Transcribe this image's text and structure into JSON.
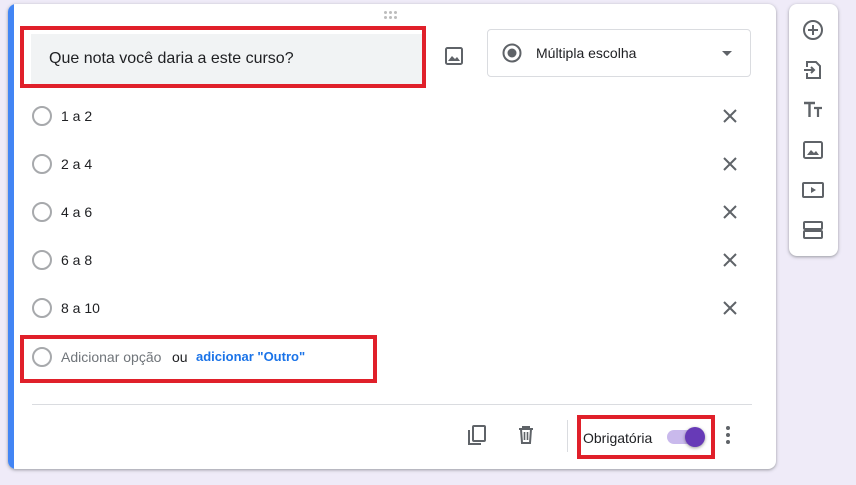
{
  "question": {
    "title": "Que nota você daria a este curso?",
    "type_label": "Múltipla escolha",
    "type_icon": "radio-button-checked-icon",
    "image_icon": "image-icon"
  },
  "options": [
    {
      "label": "1 a 2"
    },
    {
      "label": "2 a 4"
    },
    {
      "label": "4 a 6"
    },
    {
      "label": "6 a 8"
    },
    {
      "label": "8 a 10"
    }
  ],
  "add_option": {
    "label": "Adicionar opção",
    "or": "ou",
    "add_other": "adicionar \"Outro\""
  },
  "footer": {
    "required_label": "Obrigatória",
    "required_on": true,
    "icons": [
      "duplicate-icon",
      "delete-icon",
      "more-vert-icon"
    ]
  },
  "side_toolbar": {
    "icons": [
      "add-question-icon",
      "import-questions-icon",
      "add-title-icon",
      "add-image-icon",
      "add-video-icon",
      "add-section-icon"
    ]
  },
  "colors": {
    "accent": "#4285f4",
    "toggle": "#673ab7",
    "link": "#1a73e8",
    "highlight": "#e0202a",
    "background": "#efebf8"
  }
}
